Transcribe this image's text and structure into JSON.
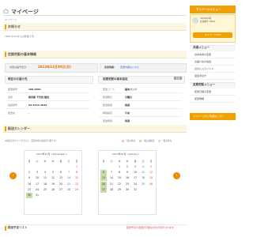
{
  "header": {
    "title": "マイページ",
    "title_en": "My Page",
    "breadcrumb": "マイページ"
  },
  "notice": {
    "title": "お知らせ",
    "text": "TEST ddddからの新着です。"
  },
  "delivery": {
    "section_title": "定期宅配の基本情報",
    "next_delivery_label": "次回お届予定日:",
    "next_delivery_date": "2013年12月30日(月)",
    "change_label": "変更情報:",
    "change_link": "変更内容はこちら",
    "address_col": {
      "title": "現在のお届け先",
      "rows": [
        {
          "label": "郵便番号",
          "value": "100-0001"
        },
        {
          "label": "住所",
          "value": "東京都 千代田 飯田"
        },
        {
          "label": "電話番号",
          "value": "03-5543-4025"
        },
        {
          "label": "配送先",
          "value": "-"
        }
      ]
    },
    "plan_col": {
      "title": "定期宅配の基本設定",
      "change_button": "変更",
      "rows": [
        {
          "label": "配送コース",
          "value": "基本パック"
        },
        {
          "label": "配送曜日",
          "value": "月曜日"
        },
        {
          "label": "配送頻度",
          "value": "毎週"
        },
        {
          "label": "時間指定",
          "value": "午前"
        },
        {
          "label": "配送時間",
          "value": "毎週"
        }
      ]
    }
  },
  "calendar": {
    "section_title": "配送カレンダー",
    "note": "★確認日をクリックすると、配送内容の確認が可能です。",
    "legend": [
      {
        "label": "一般お休み",
        "color": "#f7c0c0"
      },
      {
        "label": "一般お届確定",
        "color": "#c9dca8"
      },
      {
        "label": "一般お休み",
        "color": "#dddddd"
      }
    ],
    "prev_label": "‹",
    "next_label": "›",
    "months": [
      {
        "title": "2013年12月",
        "sub": "<December>",
        "weekdays": [
          "月",
          "火",
          "水",
          "木",
          "金",
          "土",
          "日"
        ],
        "weeks": [
          [
            "",
            "",
            "",
            "",
            "",
            "",
            "1"
          ],
          [
            "2",
            "3",
            "4",
            "5",
            "6",
            "7",
            "8"
          ],
          [
            "9",
            "10",
            "11",
            "12",
            "13",
            "14",
            "15"
          ],
          [
            "16",
            "17",
            "18",
            "19",
            "20",
            "21",
            "22"
          ],
          [
            "23",
            "24",
            "25",
            "26",
            "27",
            "28",
            "29"
          ],
          [
            "30",
            "31",
            "",
            "",
            "",
            "",
            ""
          ]
        ]
      },
      {
        "title": "2014年01月",
        "sub": "<January>",
        "weekdays": [
          "月",
          "火",
          "水",
          "木",
          "金",
          "土",
          "日"
        ],
        "weeks": [
          [
            "",
            "",
            "1",
            "2",
            "3",
            "4",
            "5"
          ],
          [
            "6",
            "7",
            "8",
            "9",
            "10",
            "11",
            "12"
          ],
          [
            "13",
            "14",
            "15",
            "16",
            "17",
            "18",
            "19"
          ],
          [
            "20",
            "21",
            "22",
            "23",
            "24",
            "25",
            "26"
          ],
          [
            "27",
            "28",
            "29",
            "30",
            "31",
            "",
            ""
          ]
        ]
      }
    ]
  },
  "plan_list": {
    "title": "配送予定リスト",
    "note": "配送予定の変更が可能な日付が表示されます"
  },
  "sidebar": {
    "member_header": "マイページメニュー",
    "user_name": "ddddddd様",
    "member_no": "会員番号:10001",
    "mypage_button": "マイページTOP",
    "sections": [
      {
        "title": "共通メニュー",
        "items": [
          "基本情報の変更",
          "お届け先の追加",
          "お気に入りリスト",
          "退会手続き"
        ]
      },
      {
        "title": "定期宅配メニュー",
        "items": [
          "配送日程の変更",
          "配送明細"
        ]
      }
    ],
    "contact": "マイページのご利用はこちら"
  },
  "colors": {
    "accent": "#f0a000",
    "highlight": "#c9dca8",
    "link": "#2a66c5",
    "alert": "#e23b3b"
  }
}
